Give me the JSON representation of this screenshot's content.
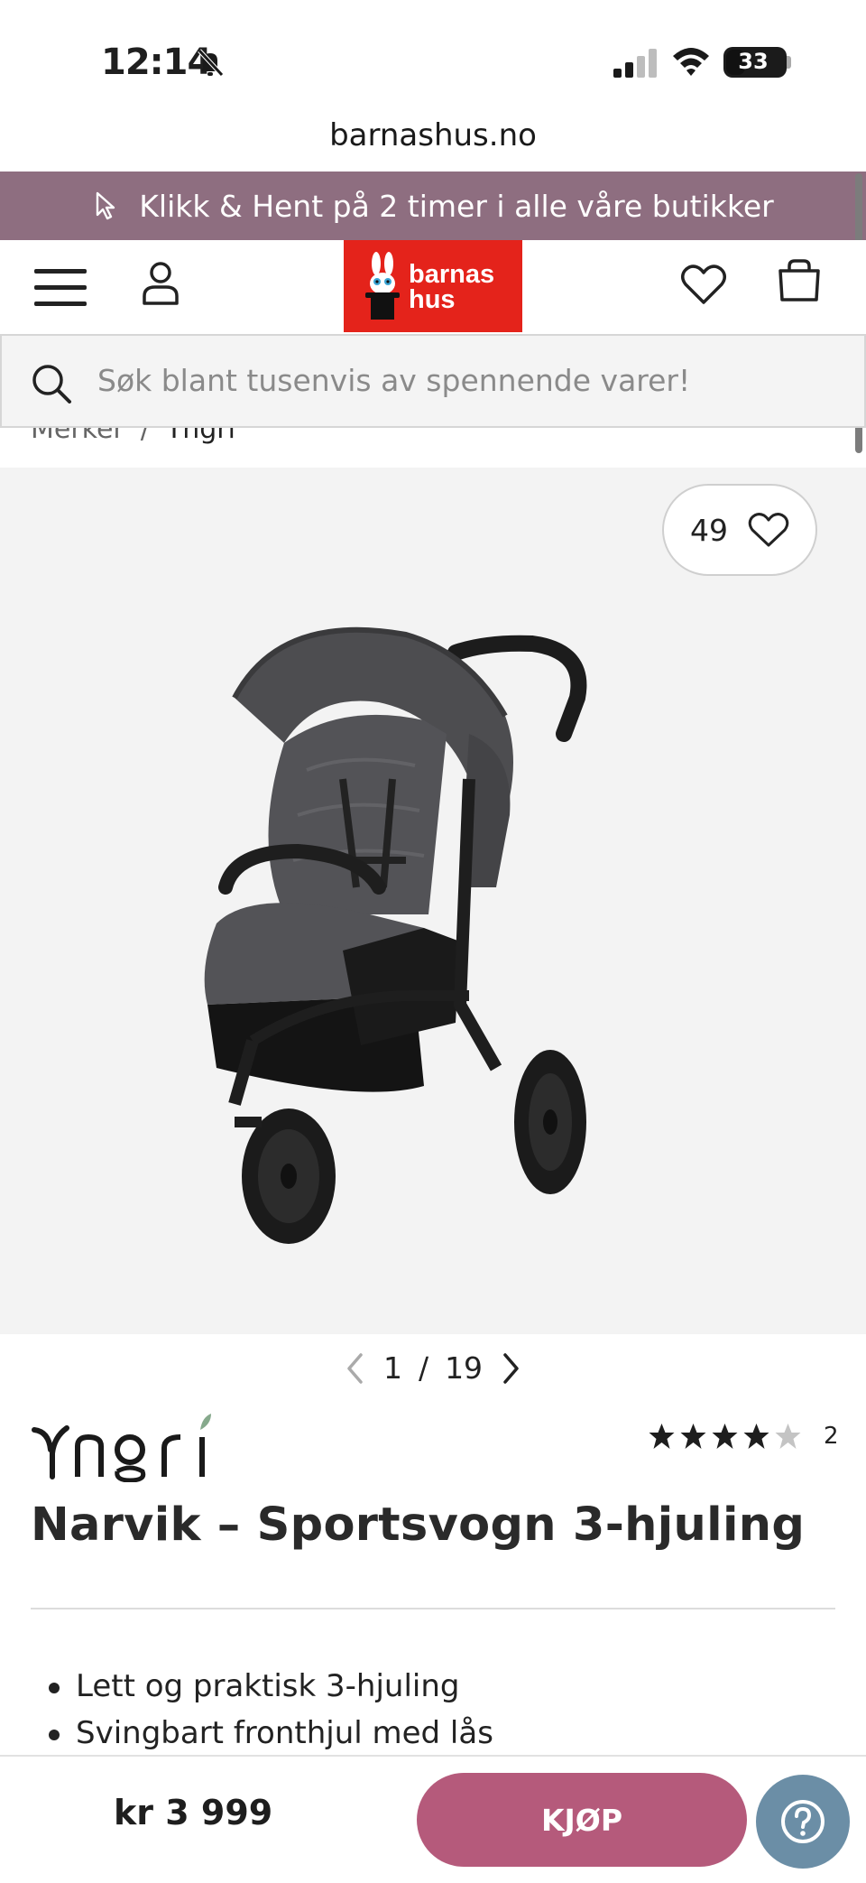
{
  "status_bar": {
    "time": "12:14",
    "battery": "33",
    "battery_level": 0.33
  },
  "browser": {
    "url": "barnashus.no"
  },
  "promo": {
    "text": "Klikk & Hent på 2 timer i alle våre butikker"
  },
  "header": {
    "logo_line1": "barnas",
    "logo_line2": "hus"
  },
  "search": {
    "placeholder": "Søk blant tusenvis av spennende varer!"
  },
  "breadcrumb": {
    "items": [
      "Merker",
      "Yngri"
    ],
    "separator": "/"
  },
  "gallery": {
    "favorites_count": "49",
    "current": "1",
    "separator": "/",
    "total": "19"
  },
  "product": {
    "brand": "Yngri",
    "title": "Narvik – Sportsvogn 3-hjuling",
    "rating": 4,
    "rating_max": 5,
    "review_count": "2",
    "features": [
      "Lett og praktisk 3-hjuling",
      "Svingbart fronthjul med lås"
    ]
  },
  "purchase": {
    "price": "kr 3 999",
    "buy_label": "KJØP"
  },
  "colors": {
    "promo_bg": "#8e6e80",
    "logo_red": "#e4231b",
    "buy_button": "#b55a7b",
    "help_button": "#6b8ea6"
  }
}
